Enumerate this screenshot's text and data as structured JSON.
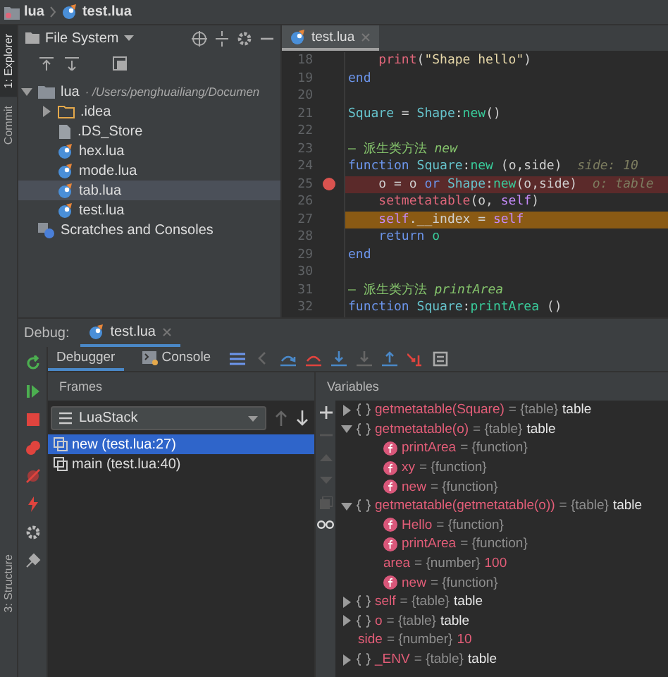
{
  "breadcrumbs": [
    {
      "label": "lua",
      "kind": "project"
    },
    {
      "label": "test.lua",
      "kind": "lua"
    }
  ],
  "side_tabs": [
    {
      "label": "1: Explorer",
      "selected": true
    },
    {
      "label": "Commit",
      "selected": false
    },
    {
      "label": "3: Structure",
      "selected": false
    }
  ],
  "project": {
    "view": "File System",
    "tree": [
      {
        "name": "lua",
        "path": " · /Users/penghuailiang/Documen",
        "kind": "folder",
        "expanded": true,
        "selected": false,
        "children": [
          {
            "name": ".idea",
            "kind": "folder",
            "expanded": false,
            "selected": false
          },
          {
            "name": ".DS_Store",
            "kind": "file",
            "selected": false
          },
          {
            "name": "hex.lua",
            "kind": "lua",
            "selected": false
          },
          {
            "name": "mode.lua",
            "kind": "lua",
            "selected": false
          },
          {
            "name": "tab.lua",
            "kind": "lua",
            "selected": true
          },
          {
            "name": "test.lua",
            "kind": "lua",
            "selected": false
          }
        ]
      },
      {
        "name": "Scratches and Consoles",
        "kind": "scratch",
        "selected": false
      }
    ]
  },
  "editor": {
    "tab": "test.lua",
    "lines": [
      {
        "number": "18",
        "breakpoint": false,
        "current": false,
        "tokens": [
          {
            "text": "    print",
            "kind": "builtin"
          },
          {
            "text": "(",
            "kind": "plain"
          },
          {
            "text": "\"Shape hello\"",
            "kind": "string"
          },
          {
            "text": ")",
            "kind": "plain"
          }
        ]
      },
      {
        "number": "19",
        "breakpoint": false,
        "current": false,
        "tokens": [
          {
            "text": "end",
            "kind": "keyword"
          }
        ]
      },
      {
        "number": "20",
        "breakpoint": false,
        "current": false
      },
      {
        "number": "21",
        "breakpoint": false,
        "current": false,
        "tokens": [
          {
            "text": "Square",
            "kind": "ident"
          },
          {
            "text": " = ",
            "kind": "plain"
          },
          {
            "text": "Shape",
            "kind": "ident"
          },
          {
            "text": ":",
            "kind": "plain"
          },
          {
            "text": "new",
            "kind": "method"
          },
          {
            "text": "()",
            "kind": "plain"
          }
        ]
      },
      {
        "number": "22",
        "breakpoint": false,
        "current": false
      },
      {
        "number": "23",
        "breakpoint": false,
        "current": false,
        "tokens": [
          {
            "text": "— 派生类方法 ",
            "kind": "comment"
          },
          {
            "text": "new",
            "kind": "comment-em"
          }
        ]
      },
      {
        "number": "24",
        "breakpoint": false,
        "current": false,
        "tokens": [
          {
            "text": "function ",
            "kind": "keyword"
          },
          {
            "text": "Square",
            "kind": "ident"
          },
          {
            "text": ":",
            "kind": "plain"
          },
          {
            "text": "new",
            "kind": "method"
          },
          {
            "text": " (o,side)",
            "kind": "plain"
          },
          {
            "text": "  side: 10",
            "kind": "hint"
          }
        ]
      },
      {
        "number": "25",
        "breakpoint": true,
        "current": false,
        "tokens": [
          {
            "text": "    o = o ",
            "kind": "plain"
          },
          {
            "text": "or ",
            "kind": "keyword"
          },
          {
            "text": "Shape",
            "kind": "ident"
          },
          {
            "text": ":",
            "kind": "plain"
          },
          {
            "text": "new",
            "kind": "method"
          },
          {
            "text": "(o,side)",
            "kind": "plain"
          },
          {
            "text": "  o: table",
            "kind": "hint"
          }
        ]
      },
      {
        "number": "26",
        "breakpoint": false,
        "current": false,
        "tokens": [
          {
            "text": "    setmetatable",
            "kind": "builtin"
          },
          {
            "text": "(o, ",
            "kind": "plain"
          },
          {
            "text": "self",
            "kind": "self"
          },
          {
            "text": ")",
            "kind": "plain"
          }
        ]
      },
      {
        "number": "27",
        "breakpoint": false,
        "current": true,
        "tokens": [
          {
            "text": "    self",
            "kind": "self"
          },
          {
            "text": ".__index = ",
            "kind": "plain"
          },
          {
            "text": "self",
            "kind": "self"
          }
        ]
      },
      {
        "number": "28",
        "breakpoint": false,
        "current": false,
        "tokens": [
          {
            "text": "    return",
            "kind": "keyword"
          },
          {
            "text": " o",
            "kind": "method"
          }
        ]
      },
      {
        "number": "29",
        "breakpoint": false,
        "current": false,
        "tokens": [
          {
            "text": "end",
            "kind": "keyword"
          }
        ]
      },
      {
        "number": "30",
        "breakpoint": false,
        "current": false
      },
      {
        "number": "31",
        "breakpoint": false,
        "current": false,
        "tokens": [
          {
            "text": "— 派生类方法 ",
            "kind": "comment"
          },
          {
            "text": "printArea",
            "kind": "comment-em"
          }
        ]
      },
      {
        "number": "32",
        "breakpoint": false,
        "current": false,
        "tokens": [
          {
            "text": "function ",
            "kind": "keyword"
          },
          {
            "text": "Square",
            "kind": "ident"
          },
          {
            "text": ":",
            "kind": "plain"
          },
          {
            "text": "printArea",
            "kind": "method"
          },
          {
            "text": " ()",
            "kind": "plain"
          }
        ]
      }
    ]
  },
  "debug": {
    "label": "Debug:",
    "tab": "test.lua",
    "views": [
      {
        "label": "Debugger",
        "selected": true,
        "kind": "debugger"
      },
      {
        "label": "Console",
        "selected": false,
        "kind": "console"
      }
    ],
    "frames": {
      "title": "Frames",
      "stack": "LuaStack",
      "items": [
        {
          "label": "new (test.lua:27)",
          "selected": true
        },
        {
          "label": "main (test.lua:40)",
          "selected": false
        }
      ]
    },
    "variables": {
      "title": "Variables",
      "items": [
        {
          "name": "getmetatable(Square)",
          "type": "= {table}",
          "value": "table",
          "kind": "table",
          "expanded": false
        },
        {
          "name": "getmetatable(o)",
          "type": "= {table}",
          "value": "table",
          "kind": "table",
          "expanded": true,
          "children": [
            {
              "name": "printArea",
              "type": "= {function}",
              "kind": "function"
            },
            {
              "name": "xy",
              "type": "= {function}",
              "kind": "function"
            },
            {
              "name": "new",
              "type": "= {function}",
              "kind": "function"
            }
          ]
        },
        {
          "name": "getmetatable(getmetatable(o))",
          "type": "= {table}",
          "value": "table",
          "kind": "table",
          "expanded": true,
          "children": [
            {
              "name": "Hello",
              "type": "= {function}",
              "kind": "function"
            },
            {
              "name": "printArea",
              "type": "= {function}",
              "kind": "function"
            },
            {
              "name": "area",
              "type": "= {number}",
              "value": "100",
              "kind": "number"
            },
            {
              "name": "new",
              "type": "= {function}",
              "kind": "function"
            }
          ]
        },
        {
          "name": "self",
          "type": "= {table}",
          "value": "table",
          "kind": "table",
          "expanded": false
        },
        {
          "name": "o",
          "type": "= {table}",
          "value": "table",
          "kind": "table",
          "expanded": false
        },
        {
          "name": "side",
          "type": "= {number}",
          "value": "10",
          "kind": "number"
        },
        {
          "name": "_ENV",
          "type": "= {table}",
          "value": "table",
          "kind": "table",
          "expanded": false
        }
      ]
    }
  }
}
